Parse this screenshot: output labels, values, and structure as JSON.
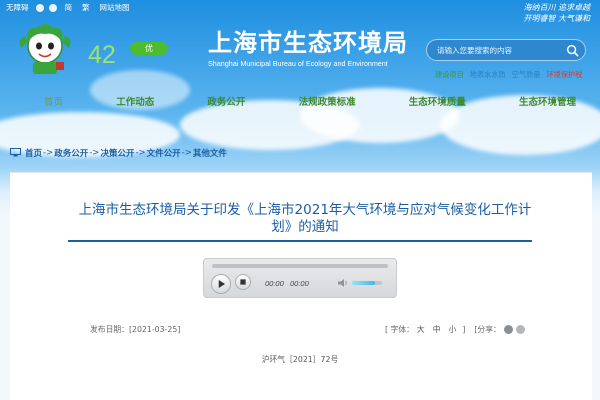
{
  "topbar": {
    "accessibility": "无障碍",
    "items": [
      "简",
      "繁",
      "网站地图"
    ]
  },
  "slogan": {
    "line1": "海纳百川  追求卓越",
    "line2": "开明睿智  大气谦和"
  },
  "air": {
    "aqi": "42",
    "level": "优"
  },
  "brand": {
    "name_cn": "上海市生态环境局",
    "name_en": "Shanghai Municipal Bureau of Ecology and Environment"
  },
  "search": {
    "placeholder": "请输入您要搜索的内容"
  },
  "quicklinks": [
    "建设项目",
    "地表水水质",
    "空气质量",
    "环境保护税"
  ],
  "nav": [
    {
      "label": "首页"
    },
    {
      "label": "工作动态"
    },
    {
      "label": "政务公开"
    },
    {
      "label": "法规政策标准"
    },
    {
      "label": "生态环境质量"
    },
    {
      "label": "生态环境管理"
    }
  ],
  "breadcrumb": [
    "首页",
    "政务公开",
    "决策公开",
    "文件公开",
    "其他文件"
  ],
  "breadcrumb_sep": "->",
  "article": {
    "title_line1": "上海市生态环境局关于印发《上海市2021年大气环境与应对气候变化工作计",
    "title_line2": "划》的通知",
    "publish_label": "发布日期：",
    "publish_date": "[2021-03-25]",
    "font_label": "[ 字体：",
    "font_sizes": [
      "大",
      "中",
      "小"
    ],
    "font_close": "]",
    "share_label": "[分享：",
    "doc_number": "沪环气［2021］72号"
  },
  "player": {
    "current_time": "00:00",
    "duration": "00:00",
    "played_fraction": 0,
    "volume_fraction": 0.75
  },
  "colors": {
    "brand_blue": "#1b5fa3",
    "nav_green": "#3d8a2e",
    "aqi_badge": "#4bbd2e"
  }
}
